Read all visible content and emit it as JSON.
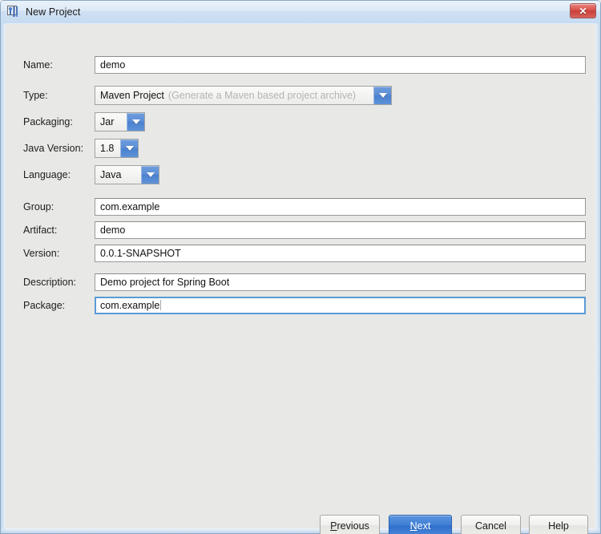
{
  "window": {
    "title": "New Project",
    "icon": "intellij-logo-icon",
    "close_label": "✕",
    "accent_blue": "#4a80cf",
    "primary_button_blue": "#3f7ed4",
    "background": "#e8e8e6",
    "titlebar_top": "#eaf2fa"
  },
  "form": {
    "fields": [
      {
        "id": "name",
        "label": "Name:",
        "kind": "text",
        "value": "demo",
        "placeholder": "",
        "focused": false
      },
      {
        "id": "type",
        "label": "Type:",
        "kind": "combo",
        "value": "Maven Project",
        "hint": "(Generate a Maven based project archive)",
        "focused": false
      },
      {
        "id": "packaging",
        "label": "Packaging:",
        "kind": "combo",
        "value": "Jar",
        "hint": "",
        "focused": false
      },
      {
        "id": "java_version",
        "label": "Java Version:",
        "kind": "combo",
        "value": "1.8",
        "hint": "",
        "focused": false
      },
      {
        "id": "language",
        "label": "Language:",
        "kind": "combo",
        "value": "Java",
        "hint": "",
        "focused": false
      },
      {
        "id": "group",
        "label": "Group:",
        "kind": "text",
        "value": "com.example",
        "placeholder": "",
        "focused": false
      },
      {
        "id": "artifact",
        "label": "Artifact:",
        "kind": "text",
        "value": "demo",
        "placeholder": "",
        "focused": false
      },
      {
        "id": "version",
        "label": "Version:",
        "kind": "text",
        "value": "0.0.1-SNAPSHOT",
        "placeholder": "",
        "focused": false
      },
      {
        "id": "description",
        "label": "Description:",
        "kind": "text",
        "value": "Demo project for Spring Boot",
        "placeholder": "",
        "focused": false
      },
      {
        "id": "package",
        "label": "Package:",
        "kind": "text",
        "value": "com.example",
        "placeholder": "",
        "focused": true
      }
    ]
  },
  "buttons": {
    "previous": {
      "label": "Previous",
      "mnemonic": "P",
      "primary": false
    },
    "next": {
      "label": "Next",
      "mnemonic": "N",
      "primary": true
    },
    "cancel": {
      "label": "Cancel",
      "mnemonic": "",
      "primary": false
    },
    "help": {
      "label": "Help",
      "mnemonic": "",
      "primary": false
    }
  }
}
